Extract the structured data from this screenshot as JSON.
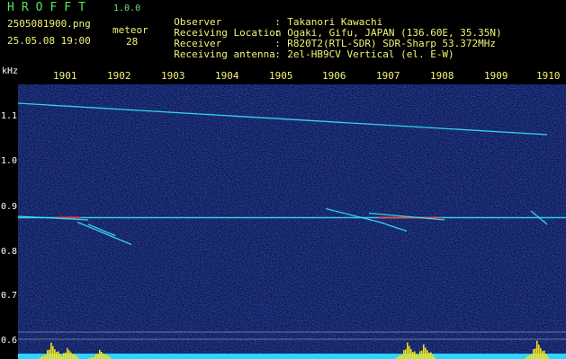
{
  "app": {
    "title": "HROFFT",
    "version": "1.0.0"
  },
  "capture": {
    "filename": "2505081900.png",
    "datetime": "25.05.08 19:00",
    "meteor_label": "meteor",
    "meteor_count": "28"
  },
  "info": [
    {
      "key": "Observer",
      "sep": ":",
      "value": "Takanori Kawachi"
    },
    {
      "key": "Receiving Location",
      "sep": ":",
      "value": "Ogaki, Gifu, JAPAN (136.60E, 35.35N)"
    },
    {
      "key": "Receiver",
      "sep": ":",
      "value": "R820T2(RTL-SDR) SDR-Sharp 53.372MHz"
    },
    {
      "key": "Receiving antenna",
      "sep": ":",
      "value": "2el-HB9CV Vertical (el. E-W)"
    }
  ],
  "axes": {
    "y_unit": "kHz",
    "x_ticks": [
      "1901",
      "1902",
      "1903",
      "1904",
      "1905",
      "1906",
      "1907",
      "1908",
      "1909",
      "1910"
    ],
    "y_ticks": [
      "1.1",
      "1.0",
      "0.9",
      "0.8",
      "0.7",
      "0.6"
    ]
  },
  "colors": {
    "background": "#000000",
    "noise_blue": "#1a2a8f",
    "signal_cyan": "#36e6ff",
    "signal_hot": "#ff3c2c",
    "amplitude_yellow": "#f4e21a",
    "amplitude_cyan": "#2ad6ff"
  },
  "chart_data": {
    "type": "heatmap",
    "x_range_minutes": [
      1900,
      1910
    ],
    "y_range_khz": [
      0.6,
      1.15
    ],
    "carrier_khz": 0.875,
    "traces": [
      {
        "x": [
          1900.0,
          1910.0
        ],
        "y": [
          1.13,
          1.06
        ]
      },
      {
        "x": [
          1900.0,
          1901.5
        ],
        "y": [
          0.878,
          0.87
        ]
      },
      {
        "x": [
          1901.3,
          1902.3
        ],
        "y": [
          0.865,
          0.815
        ]
      },
      {
        "x": [
          1901.5,
          1902.0
        ],
        "y": [
          0.86,
          0.835
        ]
      },
      {
        "x": [
          1905.9,
          1906.9
        ],
        "y": [
          0.895,
          0.865
        ]
      },
      {
        "x": [
          1906.7,
          1908.1
        ],
        "y": [
          0.885,
          0.87
        ]
      },
      {
        "x": [
          1906.9,
          1907.4
        ],
        "y": [
          0.865,
          0.845
        ]
      },
      {
        "x": [
          1909.7,
          1910.0
        ],
        "y": [
          0.89,
          0.86
        ]
      }
    ],
    "amplitude_bursts": [
      {
        "x": 1900.8,
        "level": 0.9
      },
      {
        "x": 1901.1,
        "level": 0.6
      },
      {
        "x": 1901.7,
        "level": 0.5
      },
      {
        "x": 1907.4,
        "level": 0.9
      },
      {
        "x": 1907.7,
        "level": 0.8
      },
      {
        "x": 1909.8,
        "level": 1.0
      }
    ]
  }
}
